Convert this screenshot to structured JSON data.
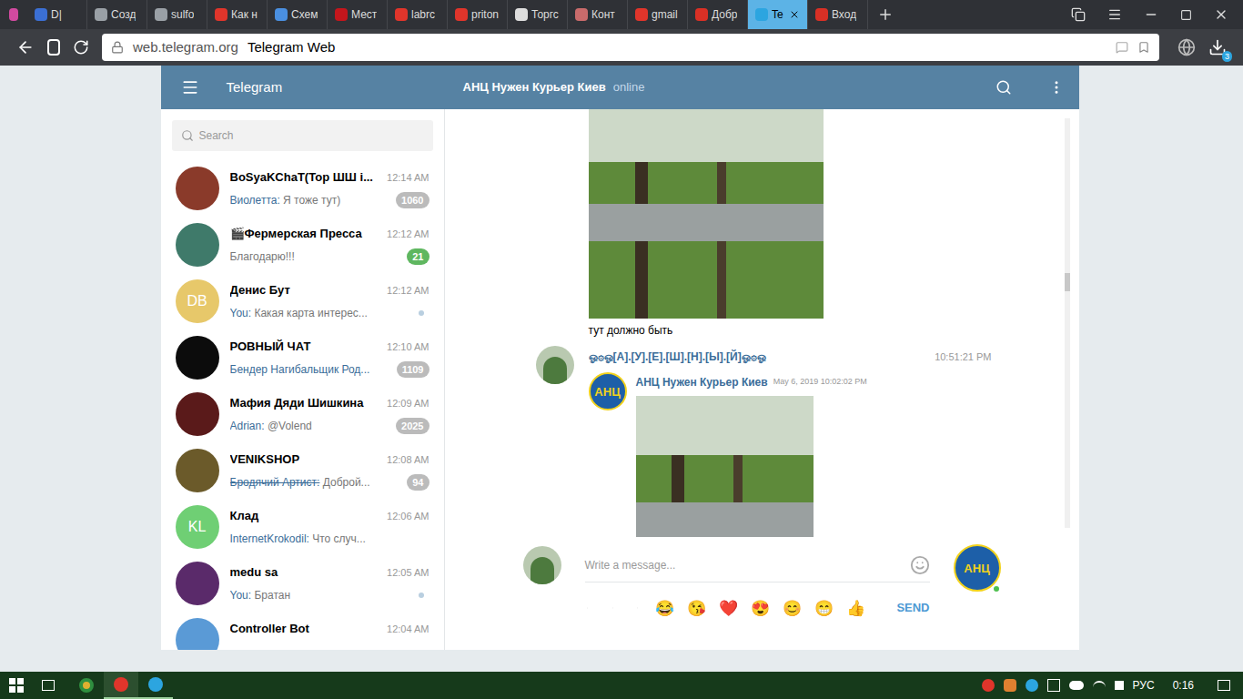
{
  "browser": {
    "tabs": [
      {
        "label": "D|",
        "selected": false,
        "color": "#3b6fd4"
      },
      {
        "label": "Созд",
        "selected": false,
        "color": "#9aa0a6"
      },
      {
        "label": "sulfo",
        "selected": false,
        "color": "#9aa0a6"
      },
      {
        "label": "Как н",
        "selected": false,
        "color": "#e0352b"
      },
      {
        "label": "Схем",
        "selected": false,
        "color": "#4a8fe0"
      },
      {
        "label": "Мест",
        "selected": false,
        "color": "#c4161c"
      },
      {
        "label": "labrc",
        "selected": false,
        "color": "#e0352b"
      },
      {
        "label": "priton",
        "selected": false,
        "color": "#e0352b"
      },
      {
        "label": "Торгс",
        "selected": false,
        "color": "#dddddd"
      },
      {
        "label": "Конт",
        "selected": false,
        "color": "#c96b6b"
      },
      {
        "label": "gmail",
        "selected": false,
        "color": "#e0352b"
      },
      {
        "label": "Добр",
        "selected": false,
        "color": "#d93025"
      },
      {
        "label": "Te",
        "selected": true,
        "color": "#2ca5e0"
      },
      {
        "label": "Вход",
        "selected": false,
        "color": "#d93025"
      }
    ],
    "url": "web.telegram.org",
    "page_title": "Telegram Web",
    "downloads_badge": "3"
  },
  "telegram": {
    "app_title": "Telegram",
    "search_placeholder": "Search",
    "chats": [
      {
        "name": "BoSyaKChaT(Тор ШШ і...",
        "time": "12:14 AM",
        "sender": "Виолетта:",
        "sender_struck": false,
        "preview": "Я тоже тут)",
        "badge": "1060",
        "badge_color": "#bbbbbb",
        "sent_unread": false,
        "initials": "",
        "avatar_color": "#8a3a2a"
      },
      {
        "name": "🎬Фермерская Пресса",
        "time": "12:12 AM",
        "sender": "",
        "sender_struck": false,
        "preview": "Благодарю!!!",
        "badge": "21",
        "badge_color": "#5fb760",
        "sent_unread": false,
        "initials": "",
        "avatar_color": "#3f7a6a"
      },
      {
        "name": "Денис Бут",
        "time": "12:12 AM",
        "sender": "You:",
        "sender_struck": false,
        "preview": "Какая карта интерес...",
        "badge": "",
        "badge_color": "#bbbbbb",
        "sent_unread": true,
        "initials": "DB",
        "avatar_color": "#e7c86a"
      },
      {
        "name": "РОВНЫЙ ЧАТ",
        "time": "12:10 AM",
        "sender": "Бендер Нагибальщик Род...",
        "sender_struck": false,
        "preview": "",
        "badge": "1109",
        "badge_color": "#bbbbbb",
        "sent_unread": false,
        "initials": "",
        "avatar_color": "#0c0c0c"
      },
      {
        "name": "Мафия Дяди Шишкина",
        "time": "12:09 AM",
        "sender": "Adrian:",
        "sender_struck": false,
        "preview": "@Volend",
        "badge": "2025",
        "badge_color": "#bbbbbb",
        "sent_unread": false,
        "initials": "",
        "avatar_color": "#5a1a1a"
      },
      {
        "name": "VENIKSHOP",
        "time": "12:08 AM",
        "sender": "Бродячий Артист:",
        "sender_struck": true,
        "preview": "Доброй...",
        "badge": "94",
        "badge_color": "#bbbbbb",
        "sent_unread": false,
        "initials": "",
        "avatar_color": "#6b5a2a"
      },
      {
        "name": "Клад",
        "time": "12:06 AM",
        "sender": "InternetKrokodil:",
        "sender_struck": false,
        "preview": "Что случ...",
        "badge": "",
        "badge_color": "#bbbbbb",
        "sent_unread": false,
        "initials": "KL",
        "avatar_color": "#6fcf74"
      },
      {
        "name": "medu sa",
        "time": "12:05 AM",
        "sender": "You:",
        "sender_struck": false,
        "preview": "Братан",
        "badge": "",
        "badge_color": "#bbbbbb",
        "sent_unread": true,
        "initials": "",
        "avatar_color": "#5a2a6a"
      },
      {
        "name": "Controller Bot",
        "time": "12:04 AM",
        "sender": "",
        "sender_struck": false,
        "preview": "",
        "badge": "",
        "badge_color": "#bbbbbb",
        "sent_unread": false,
        "initials": "",
        "avatar_color": "#5a9ad6"
      }
    ],
    "chat": {
      "title": "АНЦ Нужен Курьер Киев",
      "status": "online",
      "logo_text": "АНЦ",
      "photo_caption": "тут должно быть",
      "message": {
        "author": "ஓ۞ஓ[А].[У].[Е].[Ш].[Н].[Ы].[Й]ஓ۞ஓ",
        "time": "10:51:21 PM",
        "forwarded_from": "АНЦ Нужен Курьер Киев",
        "forwarded_date": "May 6, 2019 10:02:02 PM"
      }
    },
    "composer": {
      "placeholder": "Write a message...",
      "emojis": [
        "😂",
        "😘",
        "❤️",
        "😍",
        "😊",
        "😁",
        "👍"
      ],
      "send": "SEND"
    }
  },
  "taskbar": {
    "language": "РУС",
    "time": "0:16"
  }
}
